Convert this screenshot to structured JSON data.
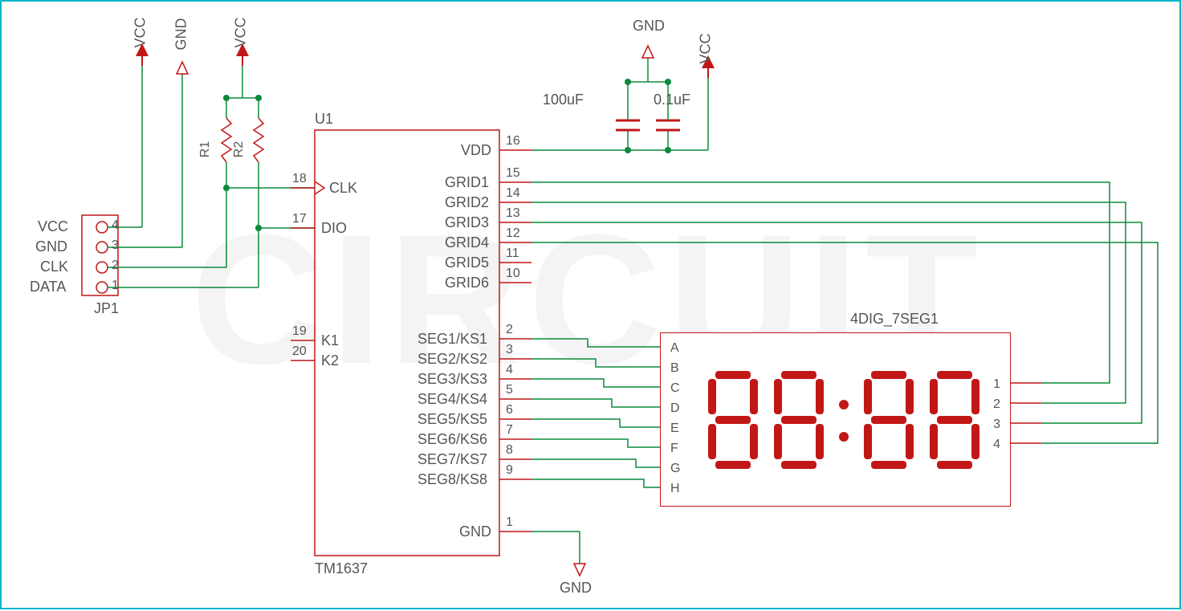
{
  "labels": {
    "vcc": "VCC",
    "gnd": "GND",
    "u1": "U1",
    "tm1637": "TM1637",
    "jp1": "JP1",
    "r1": "R1",
    "r2": "R2",
    "cap1": "100uF",
    "cap2": "0.1uF",
    "display_name": "4DIG_7SEG1"
  },
  "watermark": "CIRCUIT",
  "connector": {
    "labels": [
      "VCC",
      "GND",
      "CLK",
      "DATA"
    ],
    "numbers": [
      "4",
      "3",
      "2",
      "1"
    ]
  },
  "ic_left_pins": [
    {
      "num": "18",
      "name": "CLK"
    },
    {
      "num": "17",
      "name": "DIO"
    },
    {
      "num": "19",
      "name": "K1"
    },
    {
      "num": "20",
      "name": "K2"
    }
  ],
  "ic_right_pins": [
    {
      "num": "16",
      "name": "VDD"
    },
    {
      "num": "15",
      "name": "GRID1"
    },
    {
      "num": "14",
      "name": "GRID2"
    },
    {
      "num": "13",
      "name": "GRID3"
    },
    {
      "num": "12",
      "name": "GRID4"
    },
    {
      "num": "11",
      "name": "GRID5"
    },
    {
      "num": "10",
      "name": "GRID6"
    },
    {
      "num": "2",
      "name": "SEG1/KS1"
    },
    {
      "num": "3",
      "name": "SEG2/KS2"
    },
    {
      "num": "4",
      "name": "SEG3/KS3"
    },
    {
      "num": "5",
      "name": "SEG4/KS4"
    },
    {
      "num": "6",
      "name": "SEG5/KS5"
    },
    {
      "num": "7",
      "name": "SEG6/KS6"
    },
    {
      "num": "8",
      "name": "SEG7/KS7"
    },
    {
      "num": "9",
      "name": "SEG8/KS8"
    },
    {
      "num": "1",
      "name": "GND"
    }
  ],
  "display_left_labels": [
    "A",
    "B",
    "C",
    "D",
    "E",
    "F",
    "G",
    "H"
  ],
  "display_right_labels": [
    "1",
    "2",
    "3",
    "4"
  ]
}
